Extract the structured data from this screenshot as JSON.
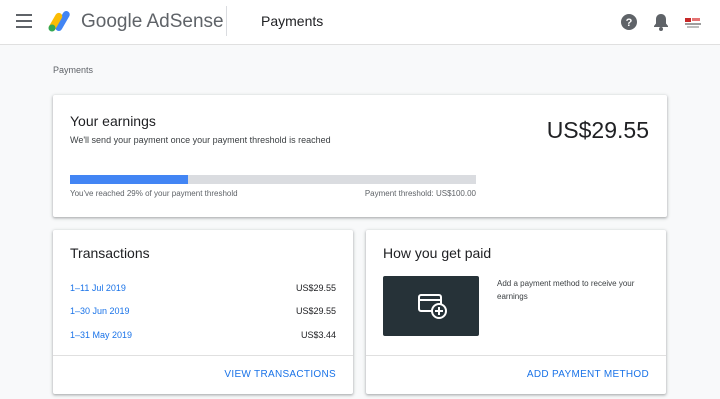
{
  "header": {
    "brand": "Google AdSense",
    "page_title": "Payments",
    "icons": {
      "menu": "menu-icon",
      "logo": "adsense-logo-icon",
      "help": "help-icon",
      "notifications": "bell-icon",
      "account": "avatar"
    }
  },
  "breadcrumb": "Payments",
  "earnings": {
    "title": "Your earnings",
    "subtitle": "We'll send your payment once your payment threshold is reached",
    "amount": "US$29.55",
    "progress_fraction": 0.29,
    "reached_text": "You've reached 29% of your payment threshold",
    "threshold_text": "Payment threshold: US$100.00"
  },
  "transactions": {
    "title": "Transactions",
    "rows": [
      {
        "period": "1–11 Jul 2019",
        "amount": "US$29.55"
      },
      {
        "period": "1–30 Jun 2019",
        "amount": "US$29.55"
      },
      {
        "period": "1–31 May 2019",
        "amount": "US$3.44"
      }
    ],
    "footer_link": "VIEW TRANSACTIONS"
  },
  "how_paid": {
    "title": "How you get paid",
    "description": "Add a payment method to receive your earnings",
    "footer_link": "ADD PAYMENT METHOD",
    "icon": "add-card-icon"
  },
  "colors": {
    "accent": "#1a73e8",
    "progress": "#4285f4",
    "payment_box": "#263238"
  }
}
